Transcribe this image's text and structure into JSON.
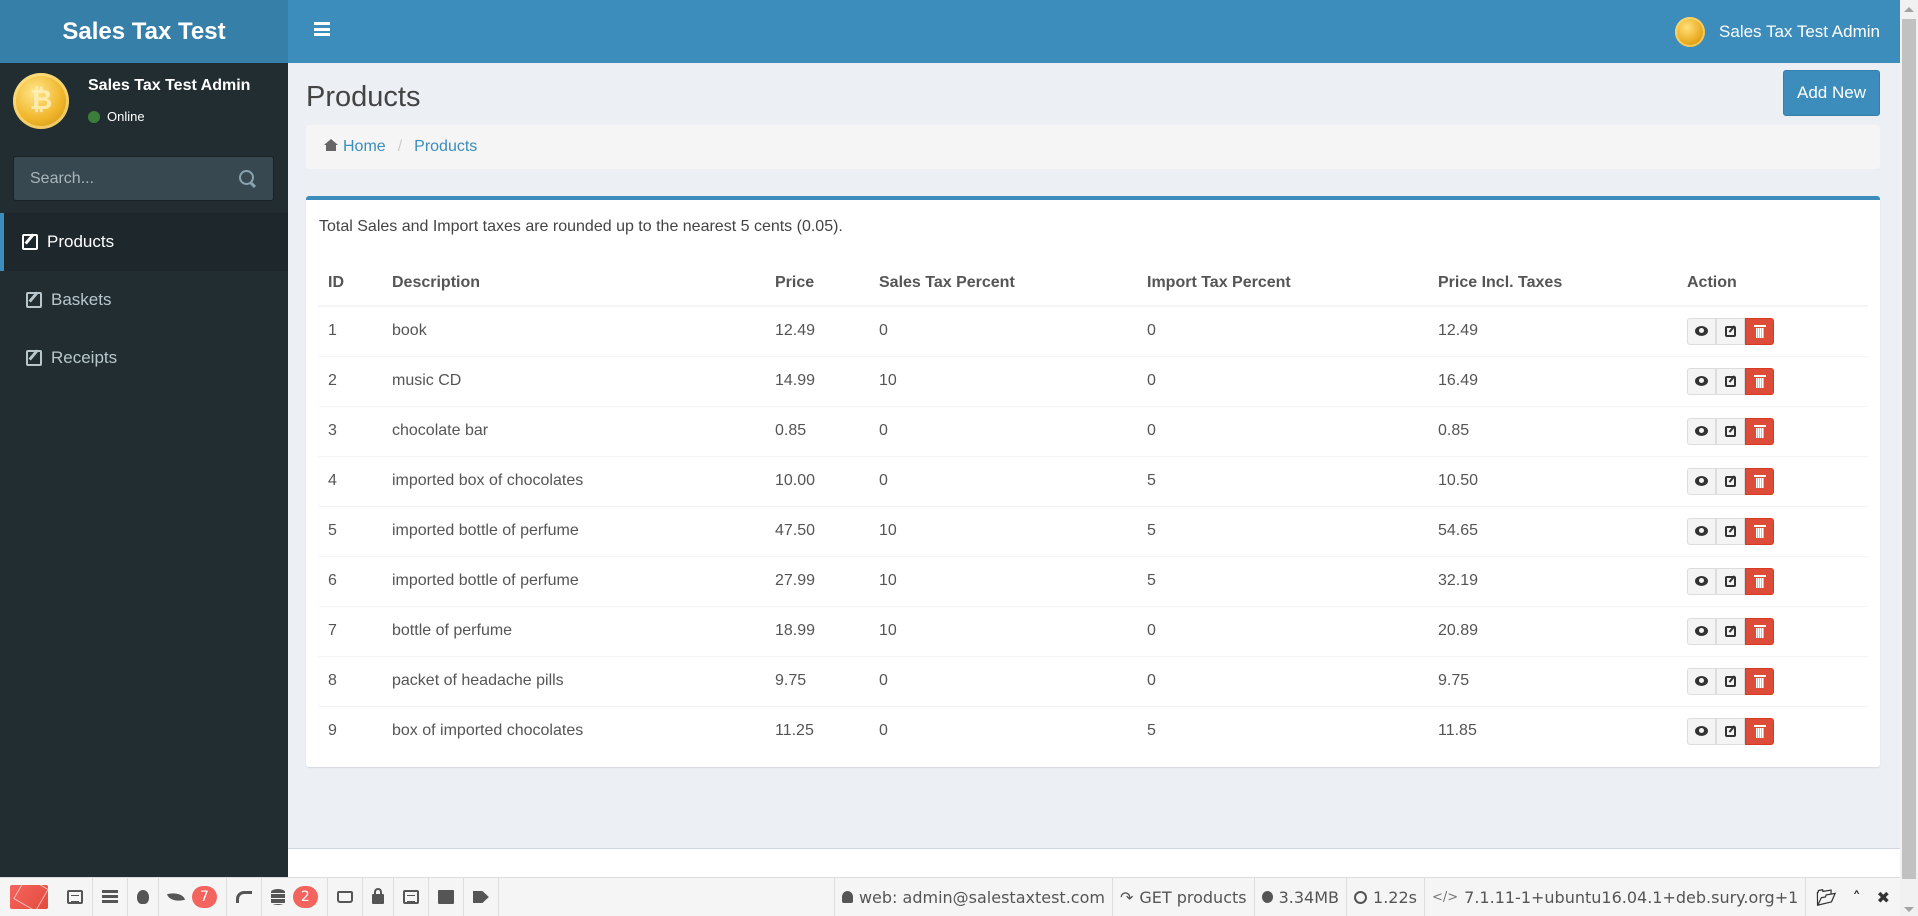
{
  "header": {
    "app_title": "Sales Tax Test",
    "user_name": "Sales Tax Test Admin"
  },
  "sidebar": {
    "user_name": "Sales Tax Test Admin",
    "status": "Online",
    "status_color": "#3b7d3a",
    "search_placeholder": "Search...",
    "items": [
      {
        "label": "Products",
        "icon": "edit-icon",
        "active": true
      },
      {
        "label": "Baskets",
        "icon": "edit-icon",
        "active": false
      },
      {
        "label": "Receipts",
        "icon": "edit-icon",
        "active": false
      }
    ]
  },
  "page": {
    "title": "Products",
    "add_button": "Add New",
    "breadcrumb": [
      {
        "label": "Home",
        "icon": "home-icon"
      },
      {
        "label": "Products"
      }
    ],
    "note": "Total Sales and Import taxes are rounded up to the nearest 5 cents (0.05)."
  },
  "table": {
    "columns": [
      "ID",
      "Description",
      "Price",
      "Sales Tax Percent",
      "Import Tax Percent",
      "Price Incl. Taxes",
      "Action"
    ],
    "rows": [
      {
        "id": "1",
        "description": "book",
        "price": "12.49",
        "sales_tax": "0",
        "import_tax": "0",
        "total": "12.49"
      },
      {
        "id": "2",
        "description": "music CD",
        "price": "14.99",
        "sales_tax": "10",
        "import_tax": "0",
        "total": "16.49"
      },
      {
        "id": "3",
        "description": "chocolate bar",
        "price": "0.85",
        "sales_tax": "0",
        "import_tax": "0",
        "total": "0.85"
      },
      {
        "id": "4",
        "description": "imported box of chocolates",
        "price": "10.00",
        "sales_tax": "0",
        "import_tax": "5",
        "total": "10.50"
      },
      {
        "id": "5",
        "description": "imported bottle of perfume",
        "price": "47.50",
        "sales_tax": "10",
        "import_tax": "5",
        "total": "54.65"
      },
      {
        "id": "6",
        "description": "imported bottle of perfume",
        "price": "27.99",
        "sales_tax": "10",
        "import_tax": "5",
        "total": "32.19"
      },
      {
        "id": "7",
        "description": "bottle of perfume",
        "price": "18.99",
        "sales_tax": "10",
        "import_tax": "0",
        "total": "20.89"
      },
      {
        "id": "8",
        "description": "packet of headache pills",
        "price": "9.75",
        "sales_tax": "0",
        "import_tax": "0",
        "total": "9.75"
      },
      {
        "id": "9",
        "description": "box of imported chocolates",
        "price": "11.25",
        "sales_tax": "0",
        "import_tax": "5",
        "total": "11.85"
      }
    ],
    "actions": [
      "view",
      "edit",
      "delete"
    ]
  },
  "debugbar": {
    "tabs": [
      {
        "name": "messages",
        "icon": "list-icon"
      },
      {
        "name": "timeline",
        "icon": "tasks-icon"
      },
      {
        "name": "exceptions",
        "icon": "bug-icon"
      },
      {
        "name": "views",
        "icon": "leaf-icon",
        "badge": "7"
      },
      {
        "name": "route",
        "icon": "share-icon"
      },
      {
        "name": "queries",
        "icon": "database-icon",
        "badge": "2"
      },
      {
        "name": "mails",
        "icon": "inbox-icon"
      },
      {
        "name": "auth",
        "icon": "lock-icon"
      },
      {
        "name": "gate",
        "icon": "list-alt-icon"
      },
      {
        "name": "session",
        "icon": "archive-icon"
      },
      {
        "name": "request",
        "icon": "tags-icon"
      }
    ],
    "user": "web: admin@salestaxtest.com",
    "route": "GET products",
    "memory": "3.34MB",
    "time": "1.22s",
    "php_version": "7.1.11-1+ubuntu16.04.1+deb.sury.org+1"
  },
  "colors": {
    "primary": "#3c8dbc",
    "logo_bg": "#367fa9",
    "sidebar_bg": "#222d32",
    "danger": "#dd4b39",
    "content_bg": "#ecf0f5"
  }
}
